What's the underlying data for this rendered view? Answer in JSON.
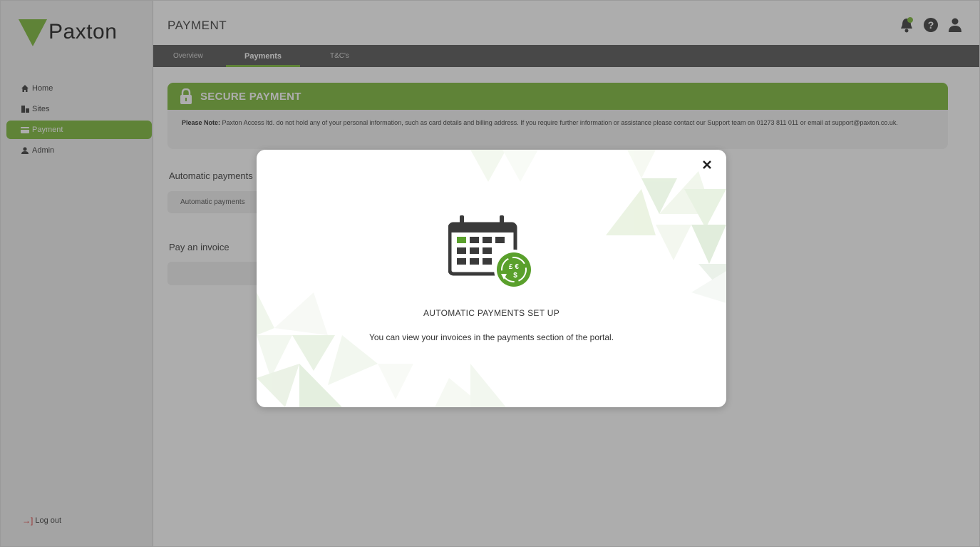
{
  "brand": {
    "name": "Paxton",
    "accent": "#8cc152"
  },
  "sidebar": {
    "items": [
      {
        "label": "Home",
        "icon": "home-icon"
      },
      {
        "label": "Sites",
        "icon": "sites-icon"
      },
      {
        "label": "Payment",
        "icon": "payment-card-icon",
        "active": true
      },
      {
        "label": "Admin",
        "icon": "user-icon"
      }
    ],
    "logout_label": "Log out"
  },
  "header": {
    "title": "PAYMENT",
    "icons": [
      "notification-bell-icon",
      "help-icon",
      "account-icon"
    ]
  },
  "tabs": [
    {
      "label": "Overview"
    },
    {
      "label": "Payments",
      "active": true
    },
    {
      "label": "T&C's"
    }
  ],
  "banner": {
    "title": "SECURE PAYMENT",
    "note_label": "Please Note:",
    "note_text": "Paxton Access ltd. do not hold any of your personal information, such as card details and billing address. If you require further information or assistance please contact our Support team on 01273 811 011 or email at support@paxton.co.uk."
  },
  "automatic": {
    "title": "Automatic payments",
    "pill_label": "Automatic payments"
  },
  "invoice": {
    "title": "Pay an invoice"
  },
  "modal": {
    "title": "AUTOMATIC PAYMENTS SET UP",
    "message": "You can view your invoices in the payments section of the portal.",
    "icon": "calendar-currency-icon",
    "close_icon": "close-icon"
  }
}
